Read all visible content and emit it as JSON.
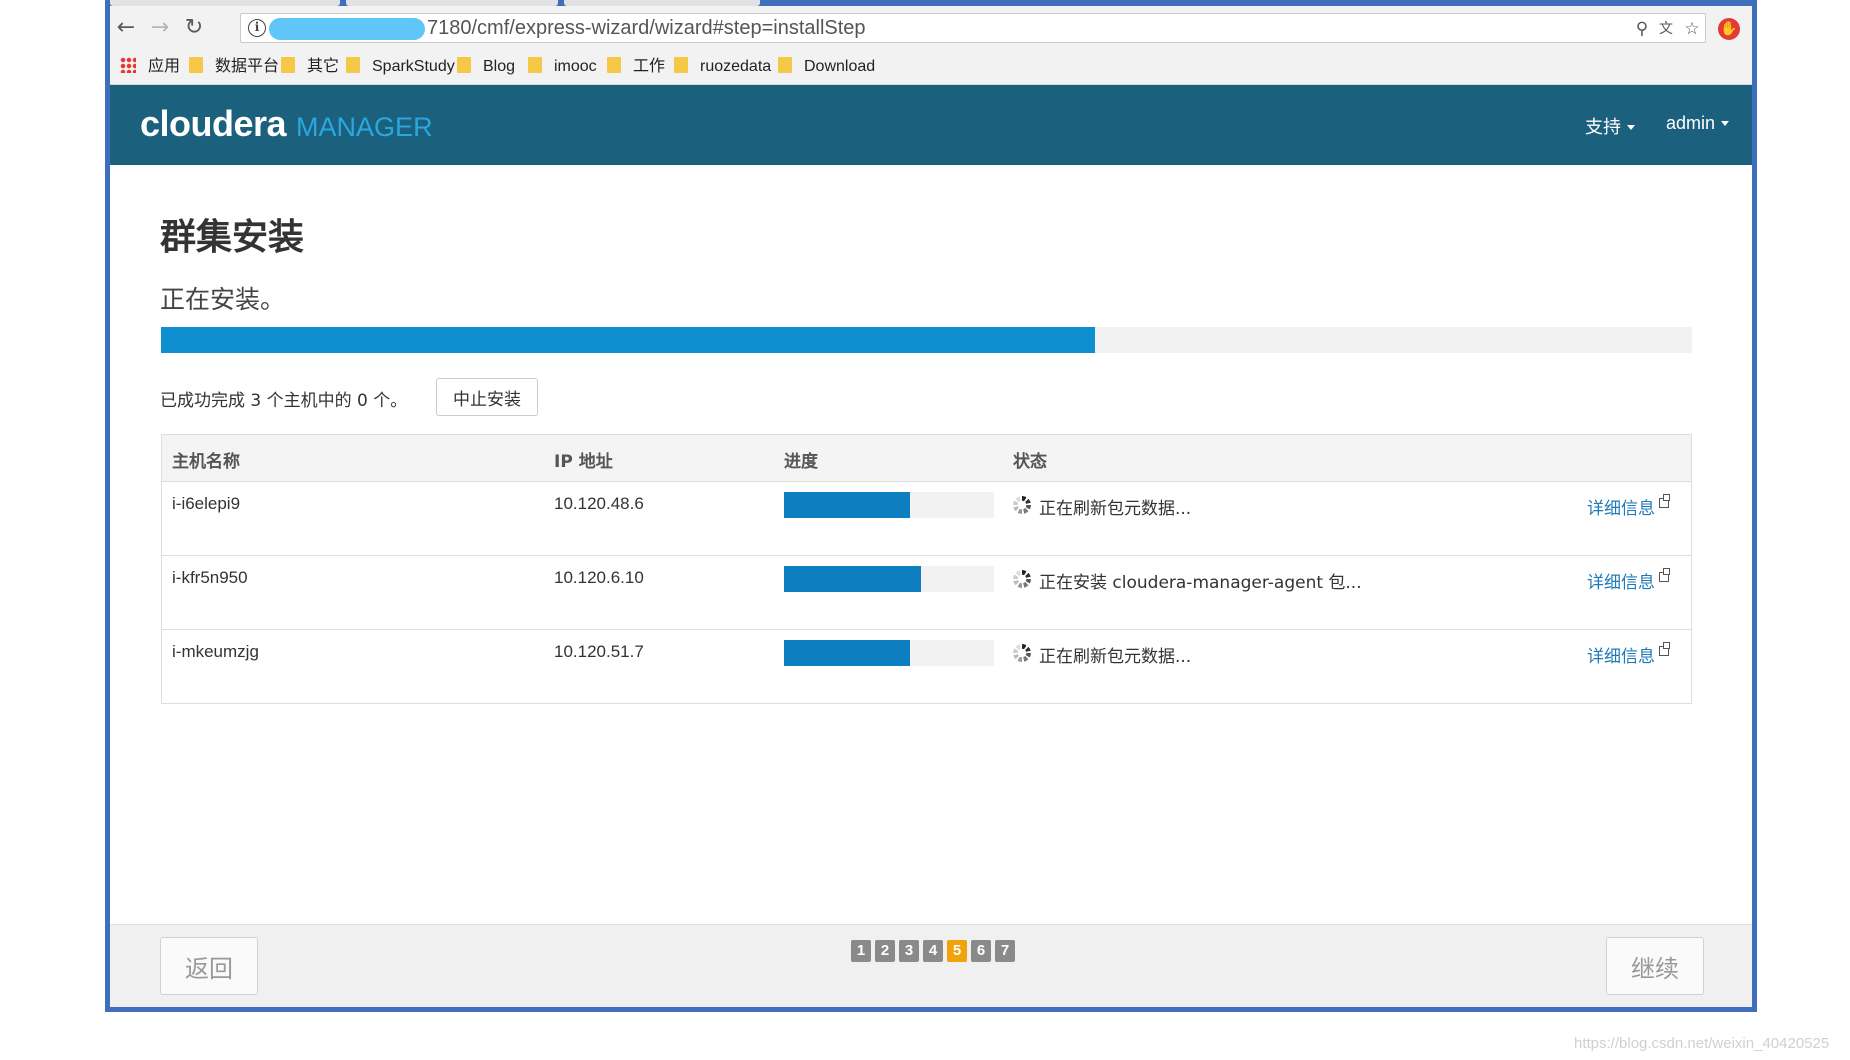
{
  "browser": {
    "url": "7180/cmf/express-wizard/wizard#step=installStep",
    "bookmarks": {
      "apps": "应用",
      "items": [
        "数据平台",
        "其它",
        "SparkStudy",
        "Blog",
        "imooc",
        "工作",
        "ruozedata",
        "Download"
      ]
    }
  },
  "app": {
    "brand_main": "cloudera",
    "brand_sub": "MANAGER",
    "nav": {
      "support": "支持",
      "user": "admin"
    }
  },
  "page": {
    "title": "群集安装",
    "subtitle": "正在安装。",
    "overall_progress_percent": 61,
    "summary": "已成功完成 3 个主机中的 0 个。",
    "abort_label": "中止安装"
  },
  "table": {
    "headers": {
      "host": "主机名称",
      "ip": "IP 地址",
      "progress": "进度",
      "status": "状态"
    },
    "detail_label": "详细信息",
    "rows": [
      {
        "host": "i-i6elepi9",
        "ip": "10.120.48.6",
        "progress_percent": 60,
        "status": "正在刷新包元数据..."
      },
      {
        "host": "i-kfr5n950",
        "ip": "10.120.6.10",
        "progress_percent": 65,
        "status": "正在安装 cloudera-manager-agent 包..."
      },
      {
        "host": "i-mkeumzjg",
        "ip": "10.120.51.7",
        "progress_percent": 60,
        "status": "正在刷新包元数据..."
      }
    ]
  },
  "footer": {
    "back_label": "返回",
    "continue_label": "继续",
    "steps": [
      "1",
      "2",
      "3",
      "4",
      "5",
      "6",
      "7"
    ],
    "current_step": "5"
  },
  "watermark": "https://blog.csdn.net/weixin_40420525",
  "colors": {
    "header_bg": "#1b617d",
    "progress_fill": "#0d8fd0",
    "active_step": "#f0a30a",
    "window_border": "#3f6ebd"
  },
  "icons": {
    "back": "arrow-left-icon",
    "forward": "arrow-right-icon",
    "reload": "reload-icon",
    "info": "info-icon",
    "key": "key-icon",
    "translate": "translate-icon",
    "star": "star-icon",
    "extension": "stop-icon",
    "spinner": "spinner-icon",
    "external_link": "external-link-icon",
    "folder": "folder-icon",
    "apps": "apps-grid-icon"
  }
}
